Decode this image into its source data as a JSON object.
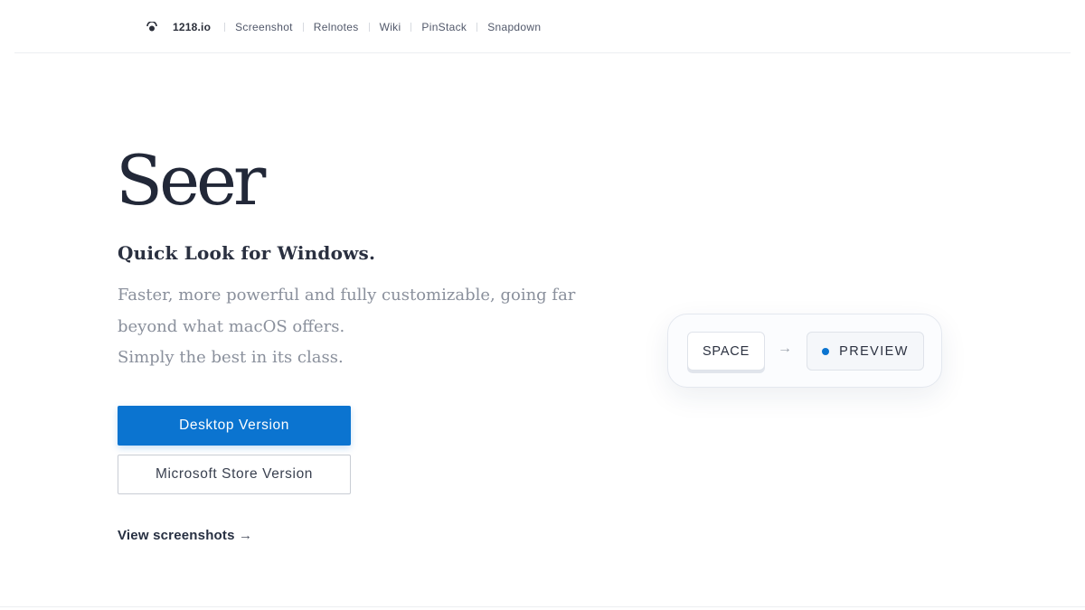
{
  "nav": {
    "brand": "1218.io",
    "links": [
      "Screenshot",
      "Relnotes",
      "Wiki",
      "PinStack",
      "Snapdown"
    ],
    "logo_icon": "eye-icon"
  },
  "hero": {
    "title": "Seer",
    "subtitle": "Quick Look for Windows.",
    "description": [
      "Faster, more powerful and fully customizable, going far",
      "beyond what macOS offers.",
      "Simply the best in its class."
    ],
    "primary_button": "Desktop Version",
    "secondary_button": "Microsoft Store Version",
    "view_link": "View screenshots",
    "view_link_arrow": "→"
  },
  "shortcut": {
    "key": "SPACE",
    "arrow": "→",
    "result": "PREVIEW"
  },
  "colors": {
    "accent": "#0b74d0",
    "text_dark": "#222838",
    "text_muted": "#8a909c"
  }
}
